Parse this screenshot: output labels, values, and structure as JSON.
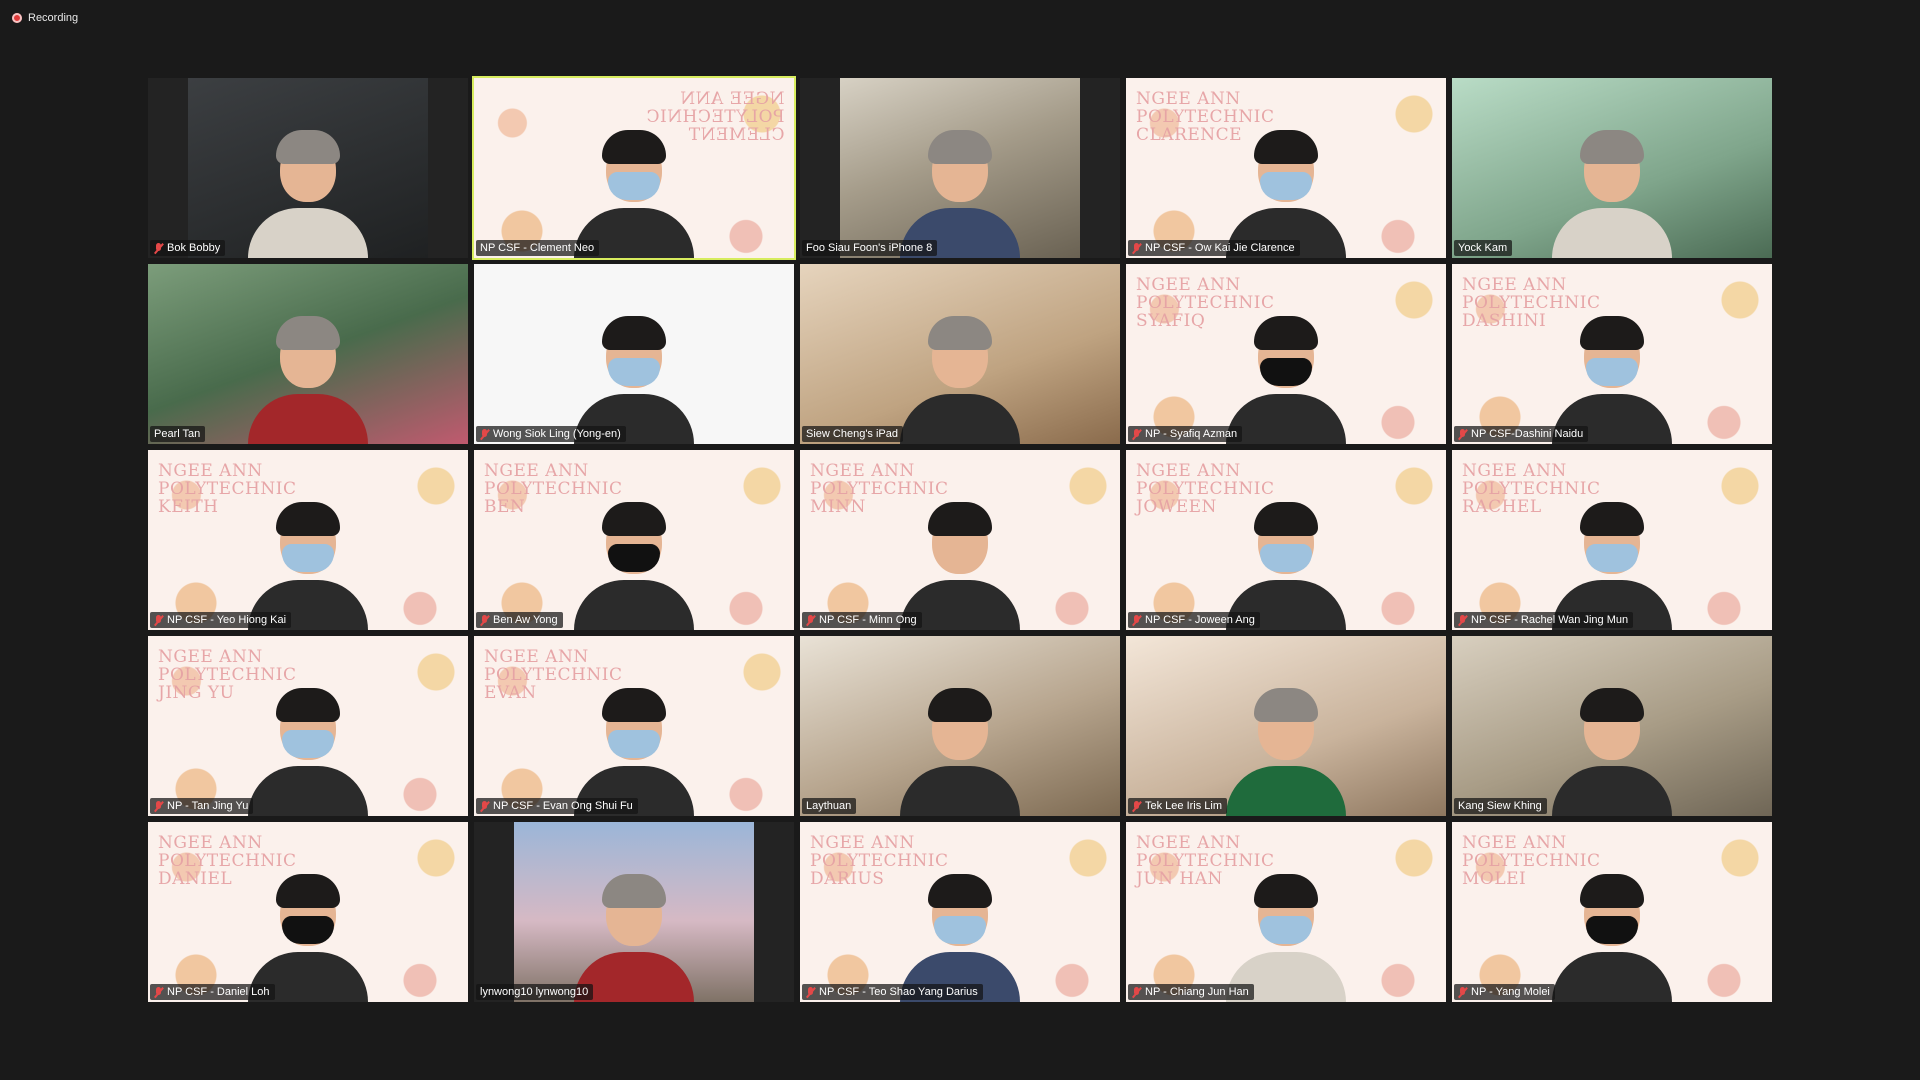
{
  "recording": {
    "label": "Recording"
  },
  "participants": [
    {
      "name": "Bok Bobby",
      "muted": true,
      "style": "bg-dark",
      "narrow": true,
      "banner": "",
      "mirror": false
    },
    {
      "name": "NP CSF - Clement Neo",
      "muted": false,
      "style": "bg-banner",
      "narrow": false,
      "banner": "NGEE ANN\nPOLYTECHNIC\nCLEMENT",
      "mirror": true,
      "active": true
    },
    {
      "name": "Foo Siau Foon's iPhone 8",
      "muted": false,
      "style": "bg-room",
      "narrow": true,
      "banner": "",
      "mirror": false
    },
    {
      "name": "NP CSF - Ow Kai Jie Clarence",
      "muted": true,
      "style": "bg-banner",
      "narrow": false,
      "banner": "NGEE ANN\nPOLYTECHNIC\nCLARENCE",
      "mirror": false
    },
    {
      "name": "Yock Kam",
      "muted": false,
      "style": "bg-green",
      "narrow": false,
      "banner": "",
      "mirror": false
    },
    {
      "name": "Pearl Tan",
      "muted": false,
      "style": "bg-lotus",
      "narrow": false,
      "banner": "",
      "mirror": false
    },
    {
      "name": "Wong Siok Ling (Yong-en)",
      "muted": true,
      "style": "bg-white",
      "narrow": false,
      "banner": "",
      "mirror": false
    },
    {
      "name": "Siew Cheng's iPad",
      "muted": false,
      "style": "bg-warm",
      "narrow": false,
      "banner": "",
      "mirror": false
    },
    {
      "name": "NP - Syafiq Azman",
      "muted": true,
      "style": "bg-banner",
      "narrow": false,
      "banner": "NGEE ANN\nPOLYTECHNIC\nSYAFIQ",
      "mirror": false
    },
    {
      "name": "NP CSF-Dashini Naidu",
      "muted": true,
      "style": "bg-banner",
      "narrow": false,
      "banner": "NGEE ANN\nPOLYTECHNIC\nDASHINI",
      "mirror": false
    },
    {
      "name": "NP CSF - Yeo Hiong Kai",
      "muted": true,
      "style": "bg-banner",
      "narrow": false,
      "banner": "NGEE ANN\nPOLYTECHNIC\nKEITH",
      "mirror": false
    },
    {
      "name": "Ben Aw Yong",
      "muted": true,
      "style": "bg-banner",
      "narrow": false,
      "banner": "NGEE ANN\nPOLYTECHNIC\nBEN",
      "mirror": false
    },
    {
      "name": "NP CSF - Minn Ong",
      "muted": true,
      "style": "bg-banner",
      "narrow": false,
      "banner": "NGEE ANN\nPOLYTECHNIC\nMINN",
      "mirror": false
    },
    {
      "name": "NP CSF - Joween Ang",
      "muted": true,
      "style": "bg-banner",
      "narrow": false,
      "banner": "NGEE ANN\nPOLYTECHNIC\nJOWEEN",
      "mirror": false
    },
    {
      "name": "NP CSF - Rachel Wan Jing Mun",
      "muted": true,
      "style": "bg-banner",
      "narrow": false,
      "banner": "NGEE ANN\nPOLYTECHNIC\nRACHEL",
      "mirror": false
    },
    {
      "name": "NP - Tan Jing Yu",
      "muted": true,
      "style": "bg-banner",
      "narrow": false,
      "banner": "NGEE ANN\nPOLYTECHNIC\nJING YU",
      "mirror": false
    },
    {
      "name": "NP CSF - Evan Ong Shui Fu",
      "muted": true,
      "style": "bg-banner",
      "narrow": false,
      "banner": "NGEE ANN\nPOLYTECHNIC\nEVAN",
      "mirror": false
    },
    {
      "name": "Laythuan",
      "muted": false,
      "style": "bg-shelf",
      "narrow": false,
      "banner": "",
      "mirror": false
    },
    {
      "name": "Tek Lee Iris Lim",
      "muted": true,
      "style": "bg-festive",
      "narrow": false,
      "banner": "",
      "mirror": false
    },
    {
      "name": "Kang Siew Khing",
      "muted": false,
      "style": "bg-curtain",
      "narrow": false,
      "banner": "",
      "mirror": false
    },
    {
      "name": "NP CSF - Daniel Loh",
      "muted": true,
      "style": "bg-banner",
      "narrow": false,
      "banner": "NGEE ANN\nPOLYTECHNIC\nDANIEL",
      "mirror": false
    },
    {
      "name": "lynwong10 lynwong10",
      "muted": false,
      "style": "bg-sky",
      "narrow": true,
      "banner": "",
      "mirror": false
    },
    {
      "name": "NP CSF - Teo Shao Yang Darius",
      "muted": true,
      "style": "bg-banner",
      "narrow": false,
      "banner": "NGEE ANN\nPOLYTECHNIC\nDARIUS",
      "mirror": false
    },
    {
      "name": "NP - Chiang Jun Han",
      "muted": true,
      "style": "bg-banner",
      "narrow": false,
      "banner": "NGEE ANN\nPOLYTECHNIC\nJUN HAN",
      "mirror": false
    },
    {
      "name": "NP - Yang Molei",
      "muted": true,
      "style": "bg-banner",
      "narrow": false,
      "banner": "NGEE ANN\nPOLYTECHNIC\nMOLEI",
      "mirror": false
    }
  ]
}
